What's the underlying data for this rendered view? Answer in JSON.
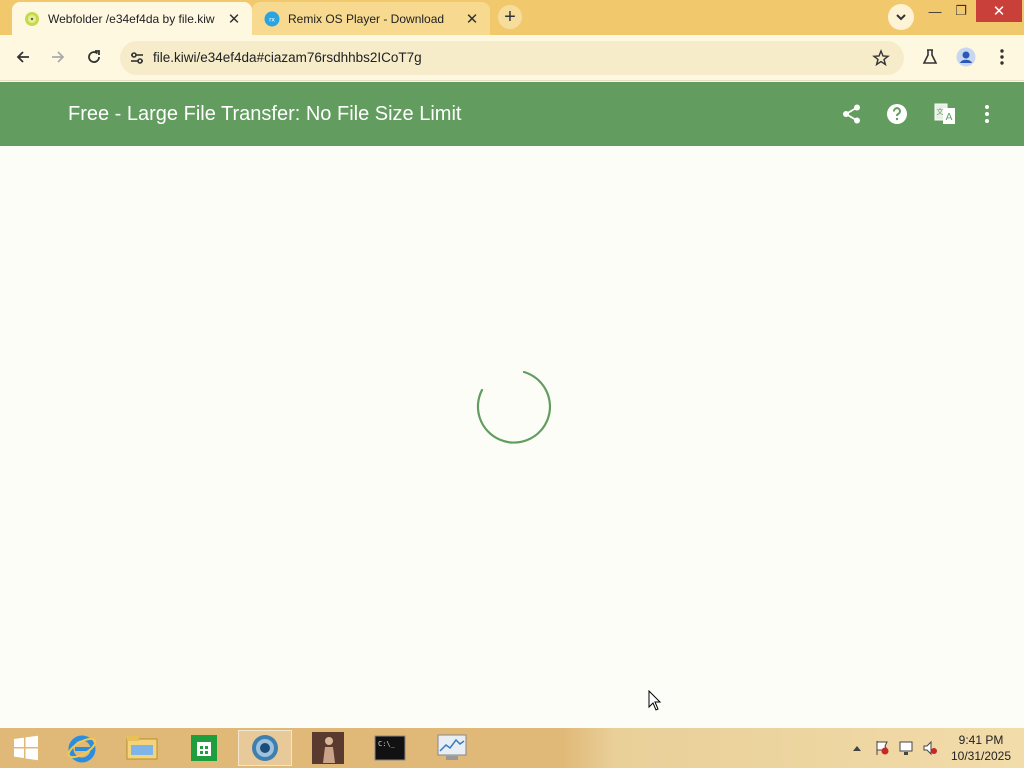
{
  "browser": {
    "tabs": [
      {
        "title": "Webfolder /e34ef4da by file.kiw",
        "favicon": "kiwi-icon",
        "active": true
      },
      {
        "title": "Remix OS Player - Download",
        "favicon": "remix-icon",
        "active": false
      }
    ],
    "new_tab_label": "+",
    "close_tab_glyph": "✕",
    "url": "file.kiwi/e34ef4da#ciazam76rsdhhbs2ICoT7g",
    "window_controls": {
      "minimize": "—",
      "restore": "❐",
      "close": "✕"
    }
  },
  "appbar": {
    "title": "Free - Large File Transfer: No File Size Limit",
    "icons": [
      "share-icon",
      "help-icon",
      "translate-icon",
      "more-vert-icon"
    ],
    "color": "#629c5e"
  },
  "content": {
    "state": "loading",
    "spinner_color": "#629c5e"
  },
  "taskbar": {
    "apps": [
      "start-button",
      "internet-explorer",
      "file-explorer",
      "store",
      "chrome",
      "media-app",
      "command-prompt",
      "resource-monitor"
    ],
    "clock": {
      "time": "9:41 PM",
      "date": "10/31/2025"
    }
  },
  "colors": {
    "tabstrip": "#f2c86d",
    "toolbar": "#fff8e1",
    "page_bg": "#fdfdf8"
  }
}
